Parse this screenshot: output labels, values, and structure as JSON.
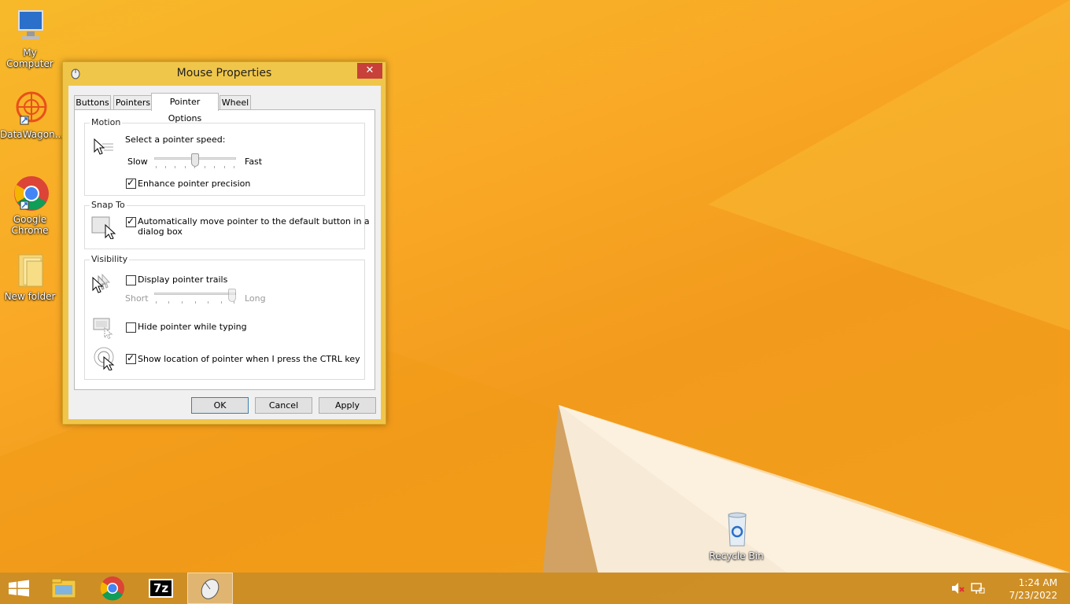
{
  "desktop": {
    "icons": [
      {
        "label": "My Computer"
      },
      {
        "label": "DataWagon..."
      },
      {
        "label": "Google Chrome"
      },
      {
        "label": "New folder"
      },
      {
        "label": "Recycle Bin"
      }
    ]
  },
  "window": {
    "title": "Mouse Properties",
    "close_label": "✕",
    "tabs": [
      {
        "label": "Buttons",
        "active": false
      },
      {
        "label": "Pointers",
        "active": false
      },
      {
        "label": "Pointer Options",
        "active": true
      },
      {
        "label": "Wheel",
        "active": false
      }
    ],
    "motion": {
      "group_label": "Motion",
      "speed_label": "Select a pointer speed:",
      "slow_label": "Slow",
      "fast_label": "Fast",
      "speed_value": 0.5,
      "precision_label": "Enhance pointer precision",
      "precision_checked": true
    },
    "snap": {
      "group_label": "Snap To",
      "snap_label_line1": "Automatically move pointer to the default button in a",
      "snap_label_line2": "dialog box",
      "snap_checked": true
    },
    "visibility": {
      "group_label": "Visibility",
      "trails_label": "Display pointer trails",
      "trails_checked": false,
      "short_label": "Short",
      "long_label": "Long",
      "trails_value": 1.0,
      "hide_label": "Hide pointer while typing",
      "hide_checked": false,
      "ctrl_label": "Show location of pointer when I press the CTRL key",
      "ctrl_checked": true
    },
    "buttons": {
      "ok": "OK",
      "cancel": "Cancel",
      "apply": "Apply"
    }
  },
  "taskbar": {
    "items": [
      {
        "icon": "start-icon"
      },
      {
        "icon": "file-explorer-icon"
      },
      {
        "icon": "chrome-icon"
      },
      {
        "icon": "7zip-icon",
        "text": "7z"
      },
      {
        "icon": "mouse-icon"
      }
    ],
    "clock_time": "1:24 AM",
    "clock_date": "7/23/2022"
  },
  "colors": {
    "wallpaper": "#f9a825",
    "close_button": "#c7403a",
    "window_frame": "#f0c64a"
  }
}
